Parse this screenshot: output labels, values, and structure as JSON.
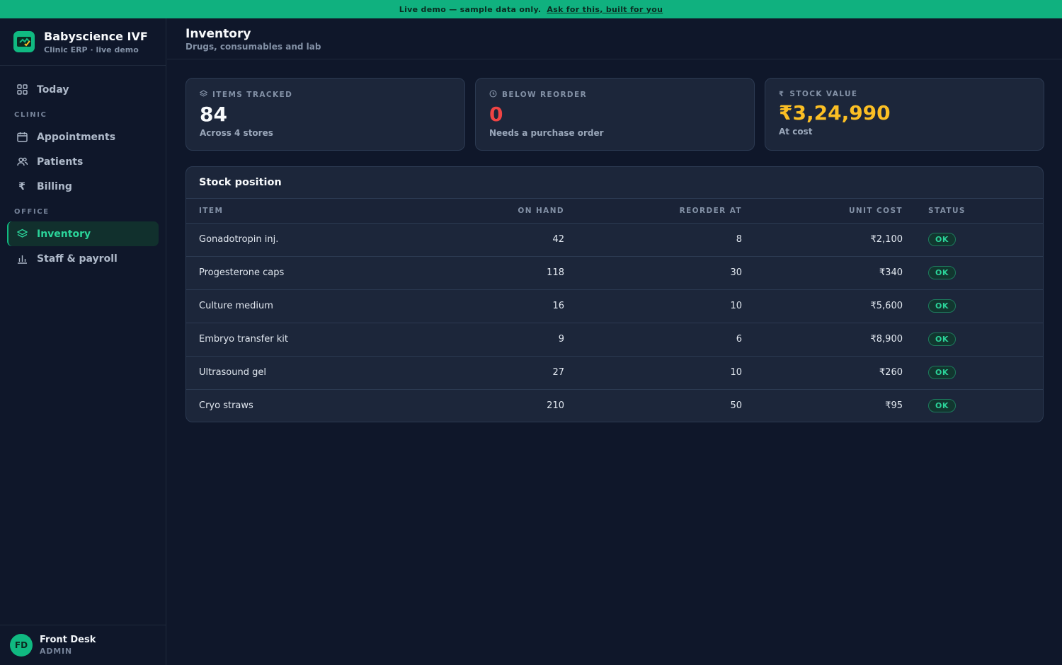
{
  "banner": {
    "text": "Live demo — sample data only.",
    "link": "Ask for this, built for you"
  },
  "brand": {
    "name": "Babyscience IVF",
    "subtitle": "Clinic ERP · live demo"
  },
  "nav": {
    "today": "Today",
    "section_clinic": "CLINIC",
    "appointments": "Appointments",
    "patients": "Patients",
    "billing": "Billing",
    "section_office": "OFFICE",
    "inventory": "Inventory",
    "staff": "Staff & payroll"
  },
  "user": {
    "initials": "FD",
    "name": "Front Desk",
    "role": "ADMIN"
  },
  "page": {
    "title": "Inventory",
    "subtitle": "Drugs, consumables and lab"
  },
  "stats": [
    {
      "label": "ITEMS TRACKED",
      "value": "84",
      "note": "Across 4 stores",
      "color": "#f8fafc",
      "icon": "layers-icon"
    },
    {
      "label": "BELOW REORDER",
      "value": "0",
      "note": "Needs a purchase order",
      "color": "#ef4444",
      "icon": "clock-icon"
    },
    {
      "label": "STOCK VALUE",
      "value": "₹3,24,990",
      "note": "At cost",
      "color": "#fbbf24",
      "icon": "rupee-icon"
    }
  ],
  "stock": {
    "title": "Stock position",
    "columns": {
      "item": "ITEM",
      "on_hand": "ON HAND",
      "reorder": "REORDER AT",
      "cost": "UNIT COST",
      "status": "STATUS"
    },
    "rows": [
      {
        "item": "Gonadotropin inj.",
        "on_hand": "42",
        "reorder": "8",
        "cost": "₹2,100",
        "status": "OK"
      },
      {
        "item": "Progesterone caps",
        "on_hand": "118",
        "reorder": "30",
        "cost": "₹340",
        "status": "OK"
      },
      {
        "item": "Culture medium",
        "on_hand": "16",
        "reorder": "10",
        "cost": "₹5,600",
        "status": "OK"
      },
      {
        "item": "Embryo transfer kit",
        "on_hand": "9",
        "reorder": "6",
        "cost": "₹8,900",
        "status": "OK"
      },
      {
        "item": "Ultrasound gel",
        "on_hand": "27",
        "reorder": "10",
        "cost": "₹260",
        "status": "OK"
      },
      {
        "item": "Cryo straws",
        "on_hand": "210",
        "reorder": "50",
        "cost": "₹95",
        "status": "OK"
      }
    ]
  }
}
